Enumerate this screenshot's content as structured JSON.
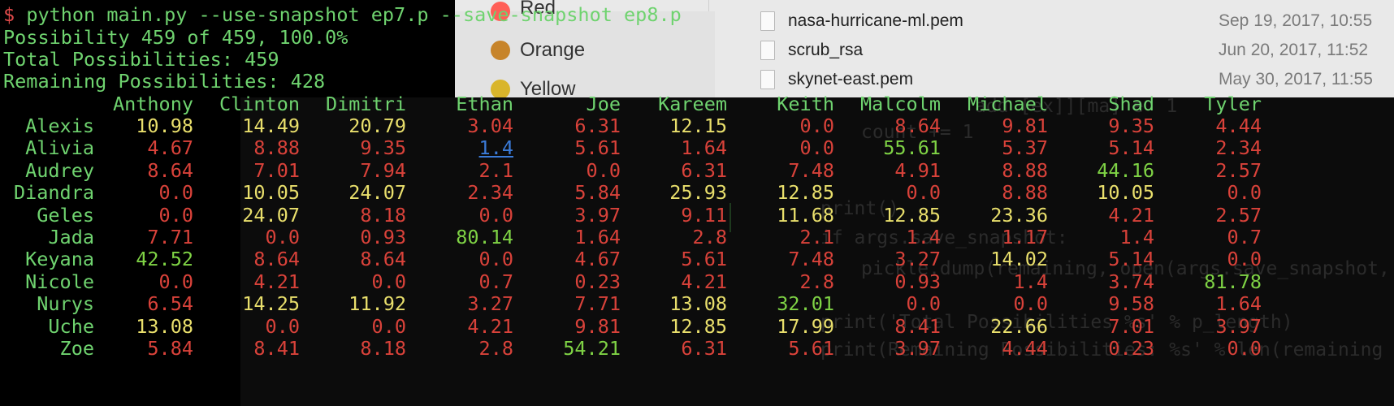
{
  "terminal": {
    "command_prompt": "$",
    "command": "python main.py --use-snapshot ep7.p --save-snapshot ep8.p",
    "progress_line": "Possibility 459 of 459, 100.0%",
    "total_line": "Total Possibilities: 459",
    "remaining_line": "Remaining Possibilities: 428"
  },
  "table": {
    "columns": [
      "Anthony",
      "Clinton",
      "Dimitri",
      "Ethan",
      "Joe",
      "Kareem",
      "Keith",
      "Malcolm",
      "Michael",
      "Shad",
      "Tyler"
    ],
    "rows": [
      {
        "name": "Alexis",
        "values": [
          "10.98",
          "14.49",
          "20.79",
          "3.04",
          "6.31",
          "12.15",
          "0.0",
          "8.64",
          "9.81",
          "9.35",
          "4.44"
        ],
        "colors": [
          "yellow",
          "yellow",
          "yellow",
          "red",
          "red",
          "yellow",
          "red",
          "red",
          "red",
          "red",
          "red"
        ]
      },
      {
        "name": "Alivia",
        "values": [
          "4.67",
          "8.88",
          "9.35",
          "1.4",
          "5.61",
          "1.64",
          "0.0",
          "55.61",
          "5.37",
          "5.14",
          "2.34"
        ],
        "colors": [
          "red",
          "red",
          "red",
          "link",
          "red",
          "red",
          "red",
          "green",
          "red",
          "red",
          "red"
        ]
      },
      {
        "name": "Audrey",
        "values": [
          "8.64",
          "7.01",
          "7.94",
          "2.1",
          "0.0",
          "6.31",
          "7.48",
          "4.91",
          "8.88",
          "44.16",
          "2.57"
        ],
        "colors": [
          "red",
          "red",
          "red",
          "red",
          "red",
          "red",
          "red",
          "red",
          "red",
          "green",
          "red"
        ]
      },
      {
        "name": "Diandra",
        "values": [
          "0.0",
          "10.05",
          "24.07",
          "2.34",
          "5.84",
          "25.93",
          "12.85",
          "0.0",
          "8.88",
          "10.05",
          "0.0"
        ],
        "colors": [
          "red",
          "yellow",
          "yellow",
          "red",
          "red",
          "yellow",
          "yellow",
          "red",
          "red",
          "yellow",
          "red"
        ]
      },
      {
        "name": "Geles",
        "values": [
          "0.0",
          "24.07",
          "8.18",
          "0.0",
          "3.97",
          "9.11",
          "11.68",
          "12.85",
          "23.36",
          "4.21",
          "2.57"
        ],
        "colors": [
          "red",
          "yellow",
          "red",
          "red",
          "red",
          "red",
          "yellow",
          "yellow",
          "yellow",
          "red",
          "red"
        ]
      },
      {
        "name": "Jada",
        "values": [
          "7.71",
          "0.0",
          "0.93",
          "80.14",
          "1.64",
          "2.8",
          "2.1",
          "1.4",
          "1.17",
          "1.4",
          "0.7"
        ],
        "colors": [
          "red",
          "red",
          "red",
          "green",
          "red",
          "red",
          "red",
          "red",
          "red",
          "red",
          "red"
        ]
      },
      {
        "name": "Keyana",
        "values": [
          "42.52",
          "8.64",
          "8.64",
          "0.0",
          "4.67",
          "5.61",
          "7.48",
          "3.27",
          "14.02",
          "5.14",
          "0.0"
        ],
        "colors": [
          "green",
          "red",
          "red",
          "red",
          "red",
          "red",
          "red",
          "red",
          "yellow",
          "red",
          "red"
        ]
      },
      {
        "name": "Nicole",
        "values": [
          "0.0",
          "4.21",
          "0.0",
          "0.7",
          "0.23",
          "4.21",
          "2.8",
          "0.93",
          "1.4",
          "3.74",
          "81.78"
        ],
        "colors": [
          "red",
          "red",
          "red",
          "red",
          "red",
          "red",
          "red",
          "red",
          "red",
          "red",
          "green"
        ]
      },
      {
        "name": "Nurys",
        "values": [
          "6.54",
          "14.25",
          "11.92",
          "3.27",
          "7.71",
          "13.08",
          "32.01",
          "0.0",
          "0.0",
          "9.58",
          "1.64"
        ],
        "colors": [
          "red",
          "yellow",
          "yellow",
          "red",
          "red",
          "yellow",
          "green",
          "red",
          "red",
          "red",
          "red"
        ]
      },
      {
        "name": "Uche",
        "values": [
          "13.08",
          "0.0",
          "0.0",
          "4.21",
          "9.81",
          "12.85",
          "17.99",
          "8.41",
          "22.66",
          "7.01",
          "3.97"
        ],
        "colors": [
          "yellow",
          "red",
          "red",
          "red",
          "red",
          "yellow",
          "yellow",
          "red",
          "yellow",
          "red",
          "red"
        ]
      },
      {
        "name": "Zoe",
        "values": [
          "5.84",
          "8.41",
          "8.18",
          "2.8",
          "54.21",
          "6.31",
          "5.61",
          "3.97",
          "4.44",
          "0.23",
          "0.0"
        ],
        "colors": [
          "red",
          "red",
          "red",
          "red",
          "green",
          "red",
          "red",
          "red",
          "red",
          "red",
          "red"
        ]
      }
    ]
  },
  "background_menu": {
    "items": [
      {
        "label": "Red",
        "color": "#ff5f57"
      },
      {
        "label": "Orange",
        "color": "#c7842a"
      },
      {
        "label": "Yellow",
        "color": "#d9b52b"
      }
    ]
  },
  "background_finder": {
    "files": [
      {
        "name": "nasa-hurricane-ml.pem",
        "date": "Sep 19, 2017, 10:55"
      },
      {
        "name": "scrub_rsa",
        "date": "Jun 20, 2017, 11:52"
      },
      {
        "name": "skynet-east.pem",
        "date": "May 30, 2017, 11:55"
      }
    ]
  },
  "background_code": {
    "lines": [
      "add [ex]][ma] e  1",
      "count += 1",
      "print()",
      "if args.save_snapshot:",
      "pickle.dump(remaining, open(args.save_snapshot,",
      "print('Total Possibilities %s' % p_length)",
      "print(Remaining Possibilities: %s' % len(remaining"
    ]
  },
  "colors": {
    "text_green": "#6fd36f",
    "value_red": "#d9423a",
    "value_yellow": "#e9df6c",
    "value_green": "#7fd345",
    "link_blue": "#3b7bd8",
    "prompt_red": "#e04a4a"
  }
}
